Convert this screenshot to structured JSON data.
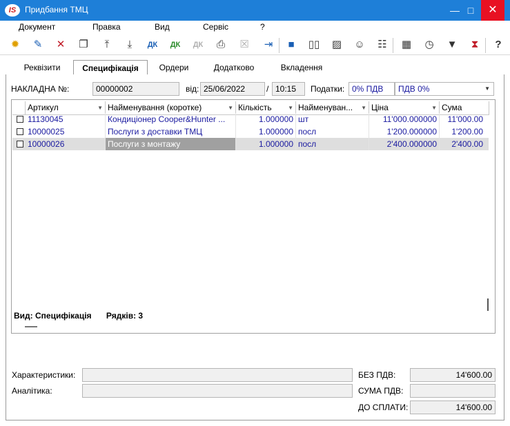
{
  "window": {
    "logo": "IS",
    "title": "Придбання ТМЦ",
    "minimize_icon": "minimize-icon",
    "maximize_icon": "maximize-icon",
    "close_icon": "close-icon"
  },
  "menu": [
    "Документ",
    "Правка",
    "Вид",
    "Сервіс",
    "?"
  ],
  "toolbar": {
    "icons": [
      "new-doc-icon",
      "edit-doc-icon",
      "delete-doc-icon",
      "copy-doc-icon",
      "insert-before-icon",
      "insert-after-icon",
      "debit-credit-icon",
      "debit-credit-green-icon",
      "debit-credit-disabled-icon",
      "print-icon",
      "export-disabled-icon",
      "exit-icon",
      "save-icon",
      "book-icon",
      "open-book-icon",
      "users-icon",
      "tree-icon",
      "table-icon",
      "history-icon",
      "filter-icon",
      "clear-filter-icon",
      "help-icon"
    ],
    "labels": {
      "debit_credit": "ДК"
    }
  },
  "tabs": [
    {
      "label": "Реквізити",
      "active": false
    },
    {
      "label": "Специфікація",
      "active": true
    },
    {
      "label": "Ордери",
      "active": false
    },
    {
      "label": "Додатково",
      "active": false
    },
    {
      "label": "Вкладення",
      "active": false
    }
  ],
  "header": {
    "invoice_label": "НАКЛАДНА №:",
    "invoice_number": "00000002",
    "date_label": "від:",
    "date": "25/06/2022",
    "time_sep": "/",
    "time": "10:15",
    "taxes_label": "Податки:",
    "tax_rate": "0% ПДВ",
    "tax_name": "ПДВ 0%"
  },
  "grid": {
    "columns": [
      "Артикул",
      "Найменування (коротке)",
      "Кількість",
      "Найменуван...",
      "Ціна",
      "Сума"
    ],
    "rows": [
      {
        "article": "11130045",
        "name": "Кондиціонер Cooper&Hunter ...",
        "qty": "1.000000",
        "unit": "шт",
        "price": "11'000.000000",
        "sum": "11'000.00"
      },
      {
        "article": "10000025",
        "name": "Послуги з доставки ТМЦ",
        "qty": "1.000000",
        "unit": "посл",
        "price": "1'200.000000",
        "sum": "1'200.00"
      },
      {
        "article": "10000026",
        "name": "Послуги з монтажу",
        "qty": "1.000000",
        "unit": "посл",
        "price": "2'400.000000",
        "sum": "2'400.00"
      }
    ],
    "footer_view": "Вид: Специфікація",
    "footer_rows": "Рядків: 3"
  },
  "bottom": {
    "characteristics_label": "Характеристики:",
    "characteristics_value": "",
    "analytics_label": "Аналітика:",
    "analytics_value": "",
    "no_vat_label": "БЕЗ ПДВ:",
    "no_vat_value": "14'600.00",
    "vat_label": "СУМА ПДВ:",
    "vat_value": "",
    "to_pay_label": "ДО СПЛАТИ:",
    "to_pay_value": "14'600.00"
  }
}
